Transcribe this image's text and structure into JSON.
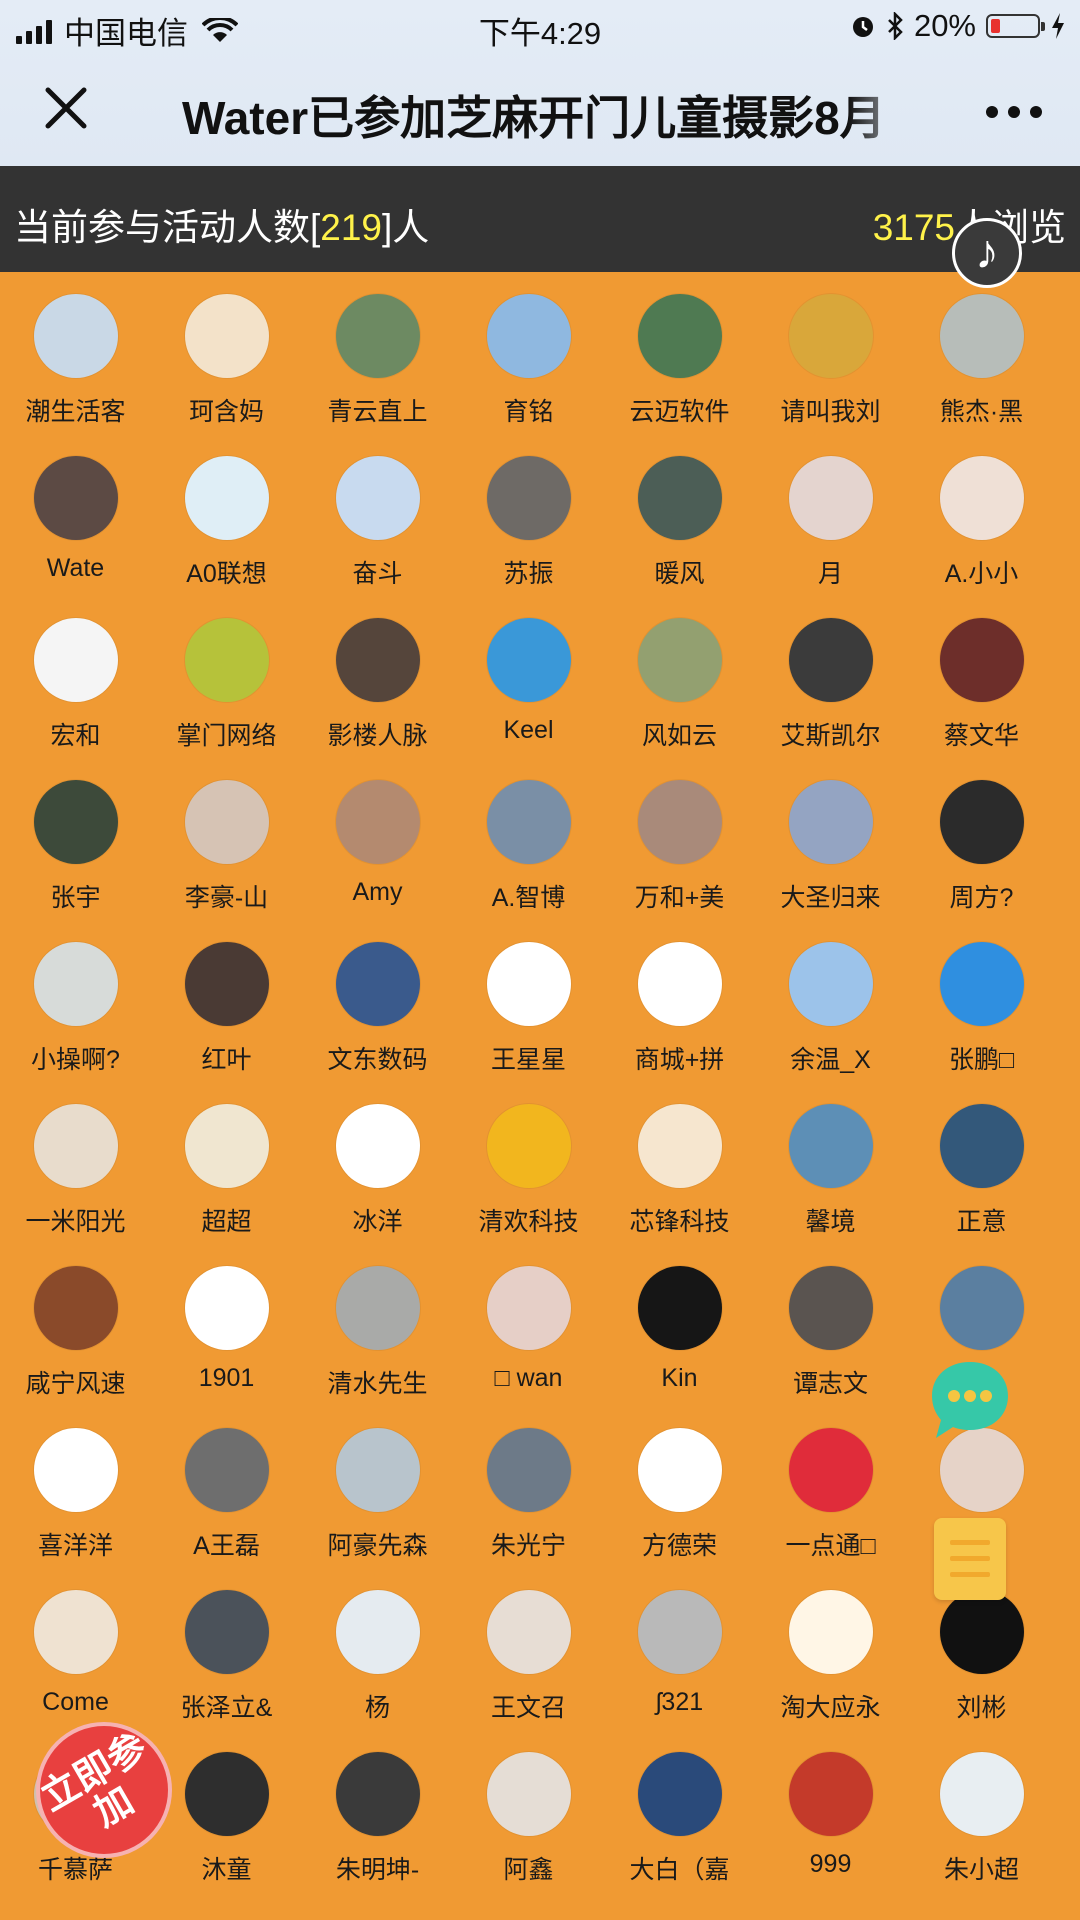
{
  "status": {
    "carrier": "中国电信",
    "time": "下午4:29",
    "battery_text": "20%",
    "battery_level": 0.2
  },
  "nav": {
    "title": "Water已参加芝麻开门儿童摄影8月"
  },
  "info": {
    "participants_prefix": "当前参与活动人数[",
    "participants_count": "219",
    "participants_suffix": "]人",
    "views_count": "3175",
    "views_suffix": "人浏览"
  },
  "music_button": "♪",
  "join_button": "立即参加",
  "members": [
    {
      "name": "潮生活客",
      "color": "#c9d8e6"
    },
    {
      "name": "珂含妈",
      "color": "#f3e2c9"
    },
    {
      "name": "青云直上",
      "color": "#6d8a62"
    },
    {
      "name": "育铭",
      "color": "#8fb8e0"
    },
    {
      "name": "云迈软件",
      "color": "#4f7a52"
    },
    {
      "name": "请叫我刘",
      "color": "#d9a73a"
    },
    {
      "name": "熊杰·黑",
      "color": "#b7bdb9"
    },
    {
      "name": "Wate",
      "color": "#5c4a44"
    },
    {
      "name": "A0联想",
      "color": "#dfeef6"
    },
    {
      "name": "奋斗",
      "color": "#c8daef"
    },
    {
      "name": "苏振",
      "color": "#6e6a66"
    },
    {
      "name": "暖风",
      "color": "#4c5e56"
    },
    {
      "name": "月",
      "color": "#e4d4cf"
    },
    {
      "name": "A.小小",
      "color": "#efe0d6"
    },
    {
      "name": "宏和",
      "color": "#f5f5f5"
    },
    {
      "name": "掌门网络",
      "color": "#b6c23a"
    },
    {
      "name": "影楼人脉",
      "color": "#55453b"
    },
    {
      "name": "Keel",
      "color": "#3a98d8"
    },
    {
      "name": "风如云",
      "color": "#93a070"
    },
    {
      "name": "艾斯凯尔",
      "color": "#3b3b3b"
    },
    {
      "name": "蔡文华",
      "color": "#6d2e2a"
    },
    {
      "name": "张宇",
      "color": "#3d4a3a"
    },
    {
      "name": "李豪-山",
      "color": "#d6c3b4"
    },
    {
      "name": "Amy",
      "color": "#b48a6f"
    },
    {
      "name": "A.智博",
      "color": "#7a8fa6"
    },
    {
      "name": "万和+美",
      "color": "#a98a7a"
    },
    {
      "name": "大圣归来",
      "color": "#94a4c2"
    },
    {
      "name": "周方?",
      "color": "#2b2b2b"
    },
    {
      "name": "小操啊?",
      "color": "#d7dbd9"
    },
    {
      "name": "红叶",
      "color": "#4a3a34"
    },
    {
      "name": "文东数码",
      "color": "#3a5a8c"
    },
    {
      "name": "王星星",
      "color": "#ffffff"
    },
    {
      "name": "商城+拼",
      "color": "#ffffff"
    },
    {
      "name": "余温_X",
      "color": "#9cc3ea"
    },
    {
      "name": "张鹏□",
      "color": "#2f8fe0"
    },
    {
      "name": "一米阳光",
      "color": "#e8dccc"
    },
    {
      "name": "超超",
      "color": "#f0e6d0"
    },
    {
      "name": "冰洋",
      "color": "#ffffff"
    },
    {
      "name": "清欢科技",
      "color": "#f2b61e"
    },
    {
      "name": "芯锋科技",
      "color": "#f6e6cf"
    },
    {
      "name": "馨境",
      "color": "#5d8fb6"
    },
    {
      "name": "正意",
      "color": "#33587a"
    },
    {
      "name": "咸宁风速",
      "color": "#8a4a2a"
    },
    {
      "name": "1901",
      "color": "#ffffff"
    },
    {
      "name": "清水先生",
      "color": "#a9aaa8"
    },
    {
      "name": "□ wan",
      "color": "#e6cfc7"
    },
    {
      "name": "Kin",
      "color": "#161616"
    },
    {
      "name": "谭志文",
      "color": "#5a5450"
    },
    {
      "name": "",
      "color": "#5b7fa0"
    },
    {
      "name": "喜洋洋",
      "color": "#ffffff"
    },
    {
      "name": "A王磊",
      "color": "#6e6e6e"
    },
    {
      "name": "阿豪先森",
      "color": "#b8c4cc"
    },
    {
      "name": "朱光宁",
      "color": "#6d7a88"
    },
    {
      "name": "方德荣",
      "color": "#ffffff"
    },
    {
      "name": "一点通□",
      "color": "#e02c3a"
    },
    {
      "name": "",
      "color": "#e6d3c8"
    },
    {
      "name": "Come",
      "color": "#efe2d1"
    },
    {
      "name": "张泽立&",
      "color": "#4b525a"
    },
    {
      "name": "杨",
      "color": "#e5ebf0"
    },
    {
      "name": "王文召",
      "color": "#e7ddd4"
    },
    {
      "name": "ʃ321",
      "color": "#b9b9b9"
    },
    {
      "name": "淘大应永",
      "color": "#fff6e6"
    },
    {
      "name": "刘彬",
      "color": "#111111"
    },
    {
      "name": "千慕萨",
      "color": "#d0c0b0"
    },
    {
      "name": "沐童",
      "color": "#2e2e2e"
    },
    {
      "name": "朱明坤-",
      "color": "#3a3a3a"
    },
    {
      "name": "阿鑫",
      "color": "#e5ddd5"
    },
    {
      "name": "大白（嘉",
      "color": "#2a4a7a"
    },
    {
      "name": "999",
      "color": "#c43a2a"
    },
    {
      "name": "朱小超",
      "color": "#e8eef2"
    }
  ]
}
